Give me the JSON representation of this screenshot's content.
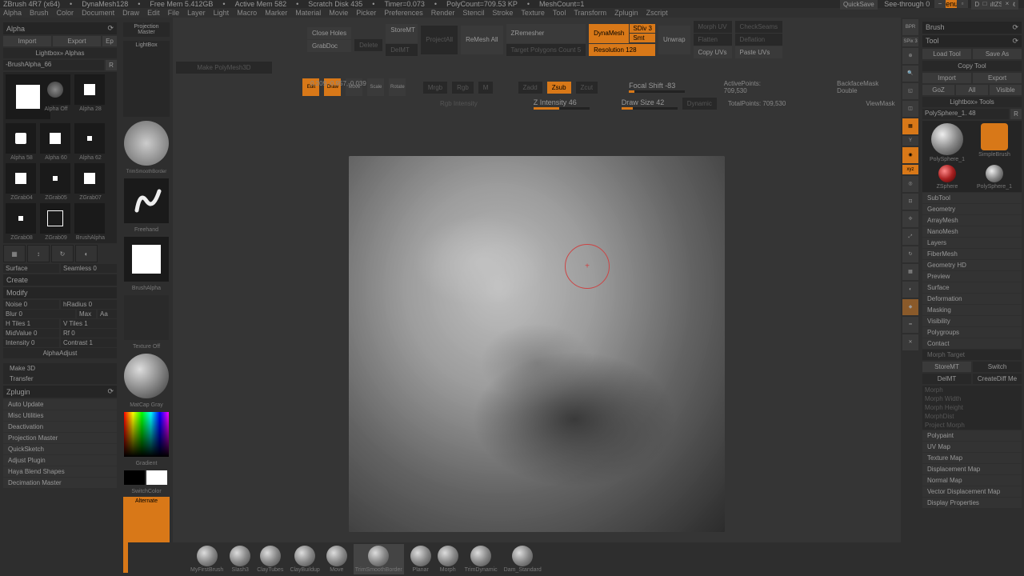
{
  "titlebar": {
    "app": "ZBrush 4R7 (x64)",
    "doc": "DynaMesh128",
    "mem": "Free Mem 5.412GB",
    "active": "Active Mem 582",
    "scratch": "Scratch Disk 435",
    "timer": "Timer=0.073",
    "poly": "PolyCount=709.53 KP",
    "mesh": "MeshCount=1",
    "quicksave": "QuickSave",
    "seethrough": "See-through  0",
    "menus": "Menus",
    "script": "DefaultZScript"
  },
  "menubar": [
    "Alpha",
    "Brush",
    "Color",
    "Document",
    "Draw",
    "Edit",
    "File",
    "Layer",
    "Light",
    "Macro",
    "Marker",
    "Material",
    "Movie",
    "Picker",
    "Preferences",
    "Render",
    "Stencil",
    "Stroke",
    "Texture",
    "Tool",
    "Transform",
    "Zplugin",
    "Zscript"
  ],
  "alpha": {
    "title": "Alpha",
    "import": "Import",
    "export": "Export",
    "ep": "Ep",
    "lightbox": "Lightbox» Alphas",
    "current": "-BrushAlpha_66",
    "r": "R",
    "off": "Alpha Off",
    "items": [
      "Alpha 28",
      "Alpha 58",
      "Alpha 60",
      "Alpha 62",
      "ZGrab04",
      "ZGrab05",
      "ZGrab07",
      "ZGrab08",
      "ZGrab09"
    ],
    "brushalpha": "BrushAlpha",
    "surface": "Surface",
    "seamless": "Seamless 0",
    "create": "Create",
    "modify": "Modify",
    "noise": "Noise 0",
    "hradius": "hRadius 0",
    "blur": "Blur 0",
    "max": "Max",
    "aa": "Aa",
    "htiles": "H Tiles 1",
    "vtiles": "V Tiles 1",
    "midvalue": "MidValue 0",
    "rf": "Rf 0",
    "intensity": "Intensity 0",
    "contrast": "Contrast 1",
    "adjust": "AlphaAdjust",
    "make3d": "Make 3D",
    "transfer": "Transfer"
  },
  "zplugin": {
    "title": "Zplugin",
    "items": [
      "Auto Update",
      "Misc Utilities",
      "Deactivation",
      "Projection Master",
      "QuickSketch",
      "Adjust Plugin",
      "Haya Blend Shapes",
      "Decimation Master"
    ]
  },
  "side": {
    "projmaster": "Projection Master",
    "lightbox": "LightBox",
    "brushlbl": "TrimSmoothBorder",
    "strokelbl": "Freehand",
    "alphalbl": "BrushAlpha",
    "texoff": "Texture Off",
    "matlbl": "MatCap Gray",
    "gradient": "Gradient",
    "switchcolor": "SwitchColor",
    "alternate": "Alternate"
  },
  "toolbar": {
    "closeholes": "Close Holes",
    "storemt": "StoreMT",
    "projectall": "ProjectAll",
    "remeshall": "ReMesh All",
    "zremesher": "ZRemesher",
    "dynamesh": "DynaMesh",
    "sdiv": "SDiv 3",
    "smt": "Smt",
    "unwrap": "Unwrap",
    "morphuv": "Morph UV",
    "checkseams": "CheckSeams",
    "grabdoc": "GrabDoc",
    "delmt": "DelMT",
    "delete": "Delete",
    "target": "Target Polygons Count 5",
    "res": "Resolution 128",
    "flatten": "Flatten",
    "deflation": "Deflation",
    "copyuv": "Copy UVs",
    "pasteuv": "Paste UVs",
    "makepoly": "Make PolyMesh3D",
    "mrgb": "Mrgb",
    "rgb": "Rgb",
    "m": "M",
    "zadd": "Zadd",
    "zsub": "Zsub",
    "zcut": "Zcut",
    "focal": "Focal Shift -83",
    "zint": "Z Intensity 46",
    "drawsize": "Draw Size 42",
    "dynamic": "Dynamic",
    "rgbint": "Rgb Intensity",
    "activepts": "ActivePoints: 709,530",
    "totalpts": "TotalPoints: 709,530",
    "backface": "BackfaceMask Double",
    "viewmask": "ViewMask",
    "edit": "Edit",
    "draw": "Draw",
    "move": "Move",
    "scale": "Scale",
    "rotate": "Rotate"
  },
  "coord": "0.209,-0.957,-0.039",
  "rtools": [
    "BPR",
    "SPix 3",
    "Scroll",
    "Zoom",
    "Actual",
    "AAHalf",
    "Persp",
    "Floor",
    "Local",
    "Frame",
    "Move",
    "Scale",
    "Rotate",
    "PolyF",
    "Transp",
    "Solo"
  ],
  "brush": {
    "title": "Brush"
  },
  "tool": {
    "title": "Tool",
    "load": "Load Tool",
    "saveas": "Save As",
    "copy": "Copy Tool",
    "import": "Import",
    "export": "Export",
    "goz": "GoZ",
    "all": "All",
    "visible": "Visible",
    "lightbox": "Lightbox» Tools",
    "current": "PolySphere_1. 48",
    "r": "R",
    "thumbs": [
      "PolySphere_1",
      "SimpleBrush",
      "ZSphere",
      "PolySphere_1"
    ],
    "sections": [
      "SubTool",
      "Geometry",
      "ArrayMesh",
      "NanoMesh",
      "Layers",
      "FiberMesh",
      "Geometry HD",
      "Preview",
      "Surface",
      "Deformation",
      "Masking",
      "Visibility",
      "Polygroups",
      "Contact"
    ],
    "morphtarget": "Morph Target",
    "storemt": "StoreMT",
    "switch": "Switch",
    "delmt": "DelMT",
    "creatediff": "CreateDiff Me",
    "morph": "Morph",
    "mwidth": "Morph Width",
    "mheight": "Morph Height",
    "morphdist": "MorphDist",
    "projmorph": "Project Morph",
    "sections2": [
      "Polypaint",
      "UV Map",
      "Texture Map",
      "Displacement Map",
      "Normal Map",
      "Vector Displacement Map",
      "Display Properties"
    ]
  },
  "shelf": [
    "MyFirstBrush",
    "Slash3",
    "ClayTubes",
    "ClayBuildup",
    "Move",
    "TrimSmoothBorder",
    "Planar",
    "Morph",
    "TrimDynamic",
    "Dam_Standard"
  ]
}
